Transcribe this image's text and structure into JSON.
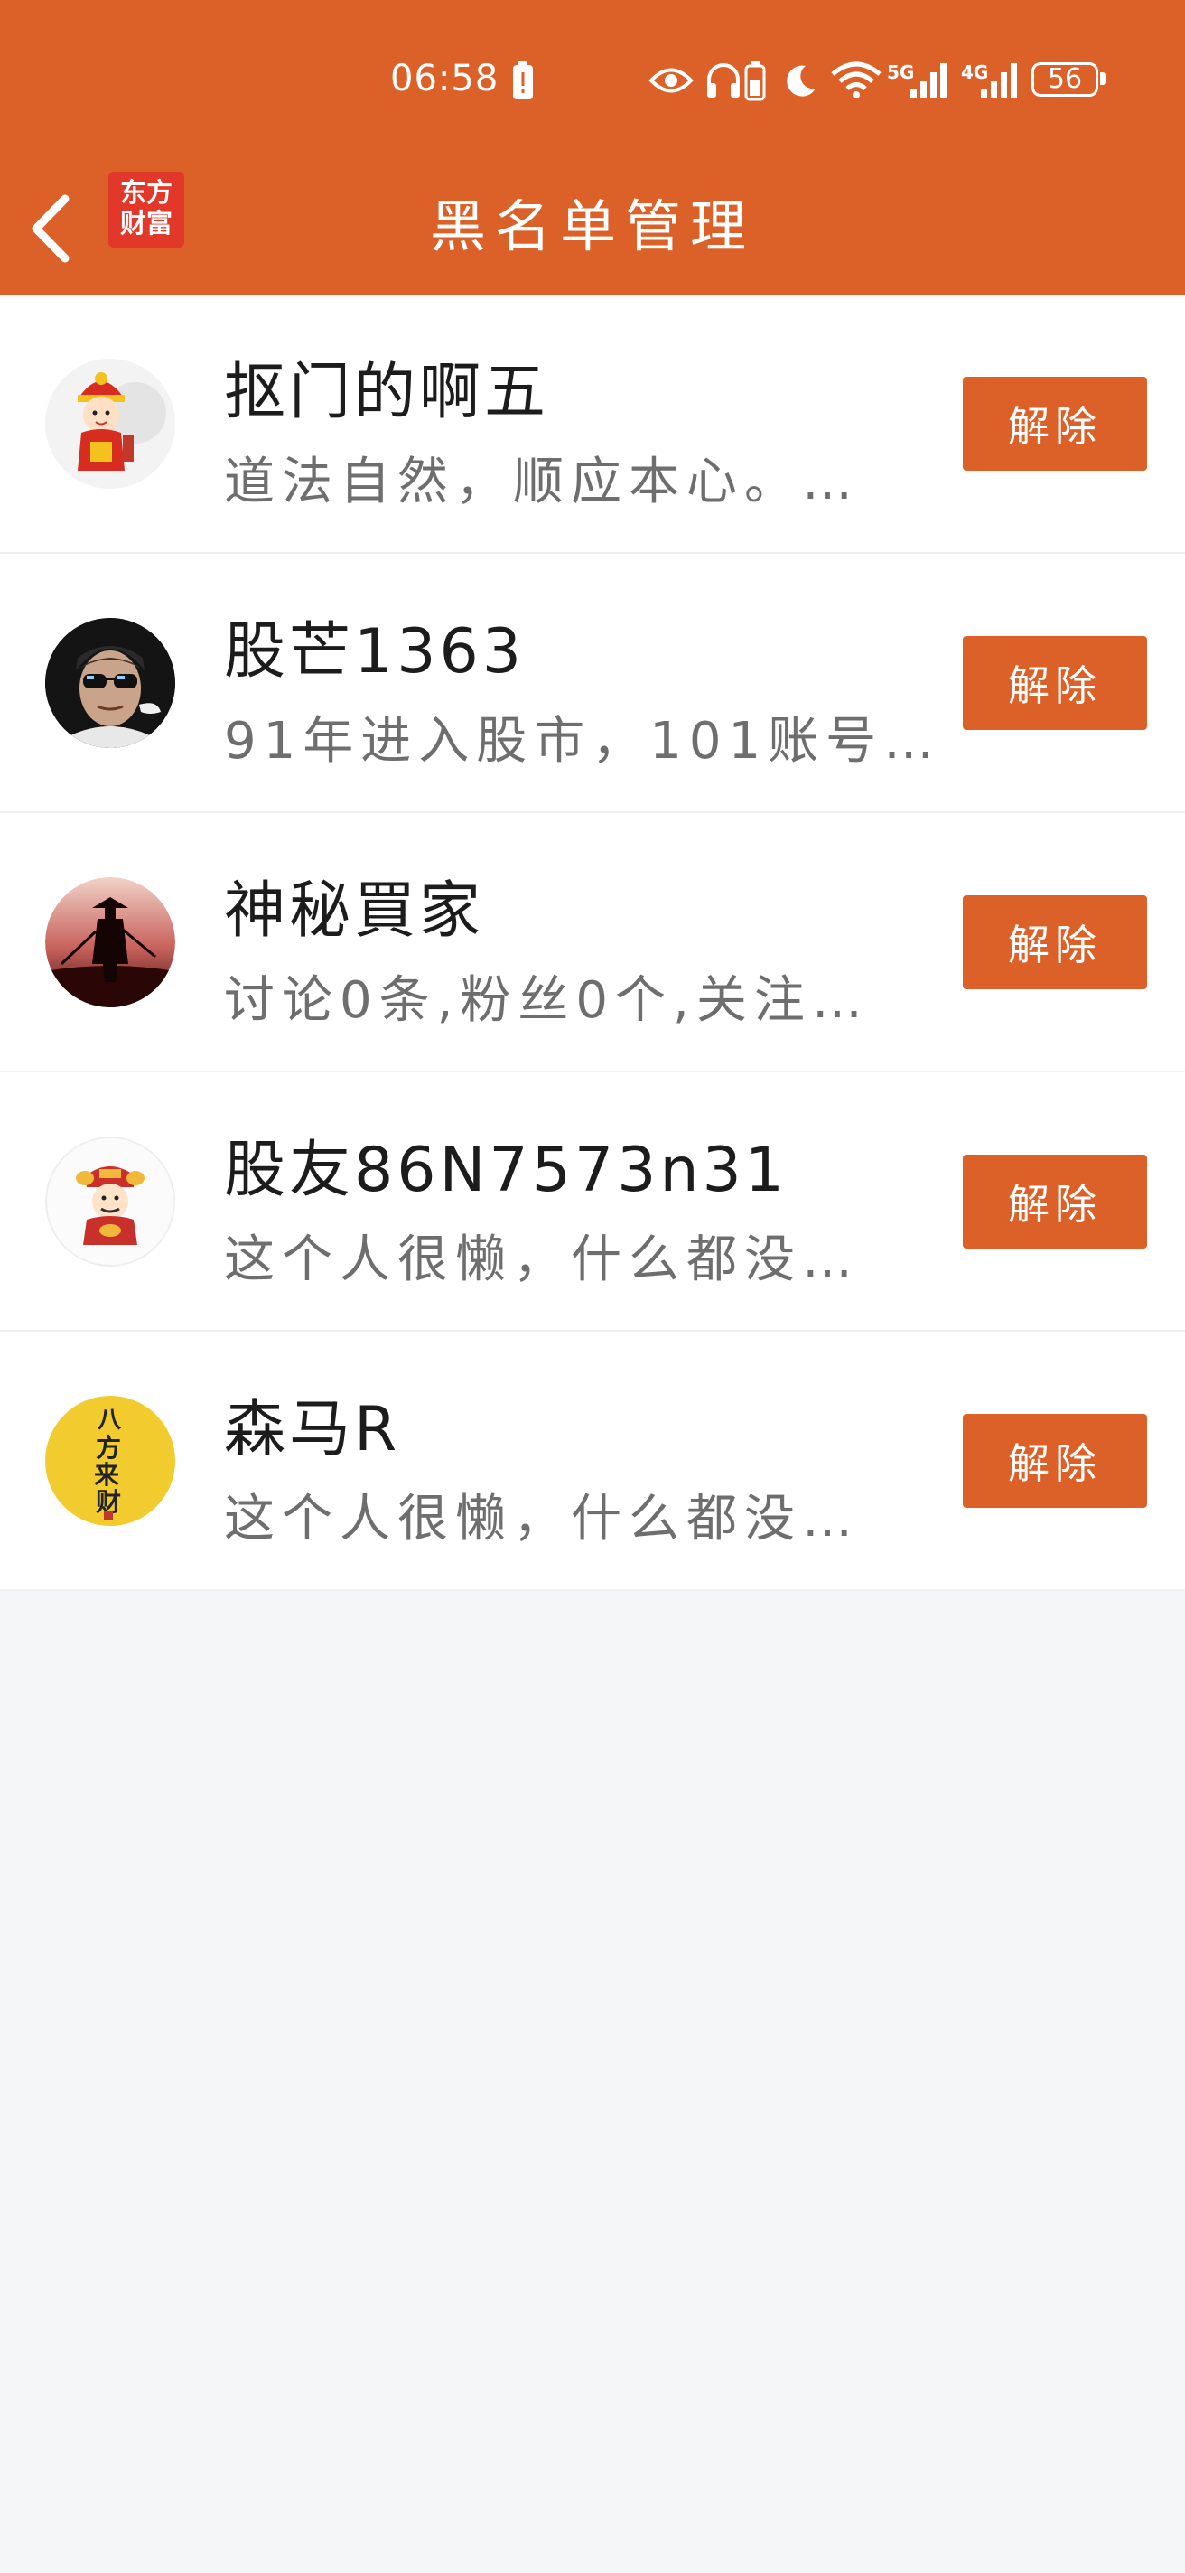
{
  "status_bar": {
    "time": "06:58",
    "battery": "56",
    "network_1": "5G",
    "network_2": "4G",
    "icons": [
      "battery-alert-icon",
      "eye-icon",
      "headphones-icon",
      "battery-small-icon",
      "moon-icon",
      "wifi-icon",
      "signal-icon",
      "signal-icon",
      "battery-icon"
    ]
  },
  "header": {
    "title": "黑名单管理",
    "logo_line1": "东方",
    "logo_line2": "财富",
    "back_icon": "chevron-left-icon"
  },
  "colors": {
    "accent": "#dc6129",
    "background": "#f5f6f8",
    "logo_red": "#e2382a"
  },
  "blacklist": [
    {
      "name": "抠门的啊五",
      "desc": "道法自然，顺应本心。…",
      "button": "解除",
      "avatar": "cartoon-god-avatar"
    },
    {
      "name": "股芒1363",
      "desc": "91年进入股市，101账号…",
      "button": "解除",
      "avatar": "sunglasses-man-avatar"
    },
    {
      "name": "神秘買家",
      "desc": "讨论0条,粉丝0个,关注…",
      "button": "解除",
      "avatar": "samurai-silhouette-avatar"
    },
    {
      "name": "股友86N7573n31",
      "desc": "这个人很懒，什么都没…",
      "button": "解除",
      "avatar": "fortune-god-avatar"
    },
    {
      "name": "森马R",
      "desc": "这个人很懒，什么都没…",
      "button": "解除",
      "avatar": "calligraphy-avatar"
    }
  ],
  "avatar_text": {
    "calligraphy": [
      "八",
      "方",
      "来",
      "财"
    ]
  }
}
